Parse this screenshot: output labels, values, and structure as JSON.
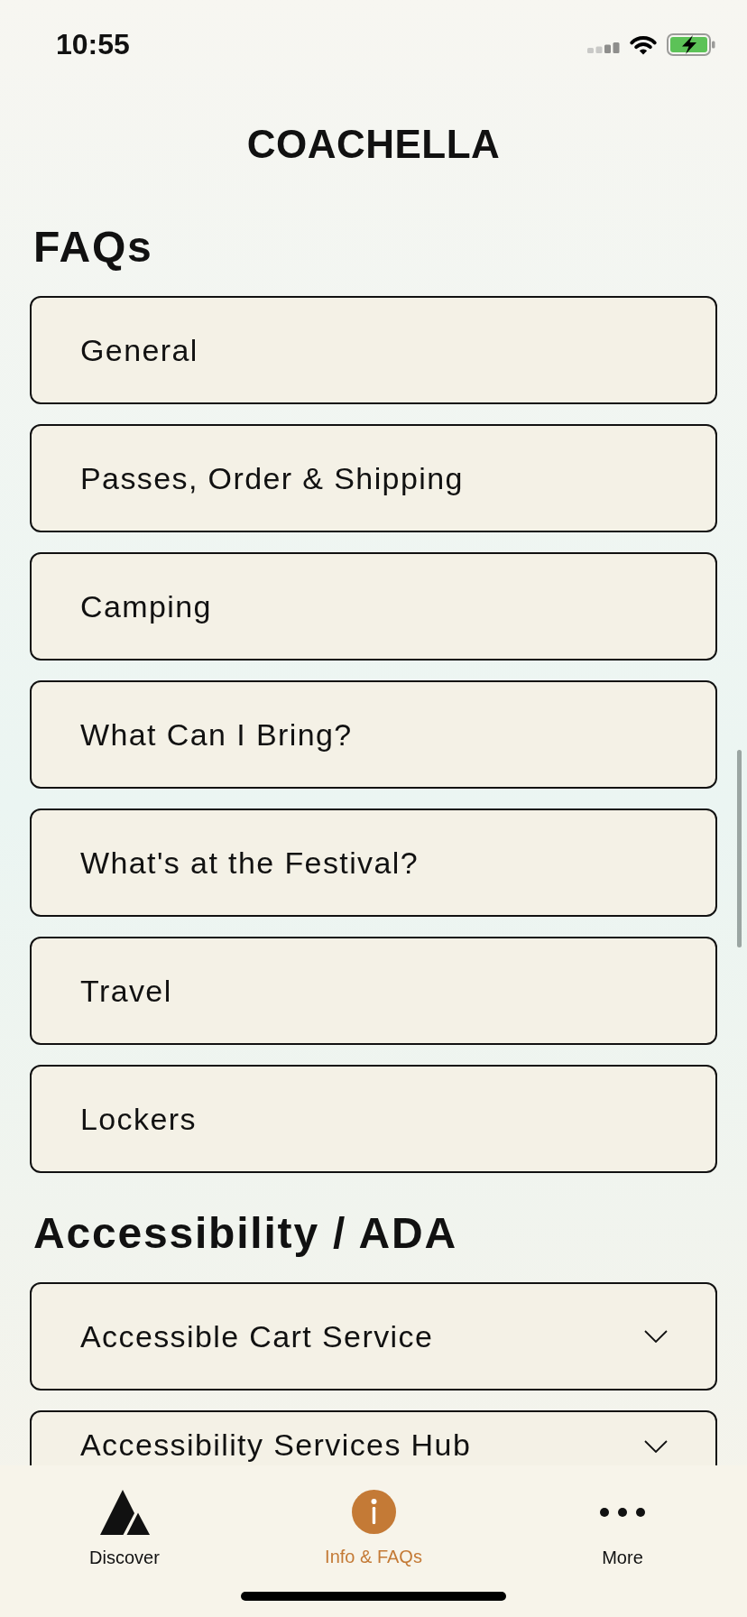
{
  "status_bar": {
    "time": "10:55"
  },
  "header": {
    "logo": "COACHELLA"
  },
  "sections": [
    {
      "title": "FAQs",
      "items": [
        {
          "label": "General",
          "kind": "link"
        },
        {
          "label": "Passes, Order & Shipping",
          "kind": "link"
        },
        {
          "label": "Camping",
          "kind": "link"
        },
        {
          "label": "What Can I Bring?",
          "kind": "link"
        },
        {
          "label": "What's at the Festival?",
          "kind": "link"
        },
        {
          "label": "Travel",
          "kind": "link"
        },
        {
          "label": "Lockers",
          "kind": "link"
        }
      ]
    },
    {
      "title": "Accessibility / ADA",
      "items": [
        {
          "label": "Accessible Cart Service",
          "kind": "accordion",
          "expanded": false
        },
        {
          "label": "Accessibility Services Hub",
          "kind": "accordion",
          "expanded": false
        }
      ]
    }
  ],
  "tab_bar": {
    "tabs": [
      {
        "label": "Discover",
        "selected": false
      },
      {
        "label": "Info & FAQs",
        "selected": true
      },
      {
        "label": "More",
        "selected": false
      }
    ]
  }
}
